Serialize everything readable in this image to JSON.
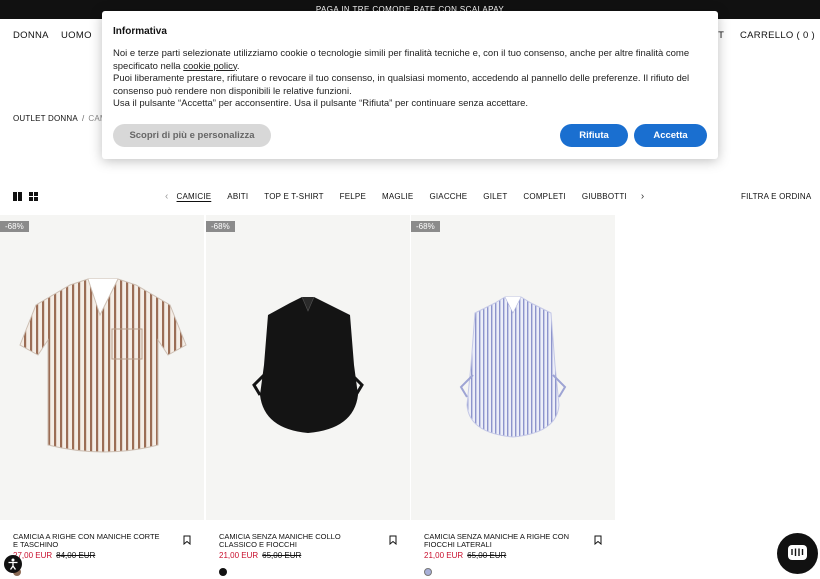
{
  "promo": {
    "text": "PAGA IN TRE COMODE RATE CON SCALAPAY"
  },
  "nav": {
    "donna": "DONNA",
    "uomo": "UOMO",
    "partial_right": "NT",
    "cart": "CARRELLO ( 0 )"
  },
  "breadcrumb": {
    "parent": "OUTLET DONNA",
    "separator": "/",
    "current": "CAM"
  },
  "categories": [
    "CAMICIE",
    "ABITI",
    "TOP E T-SHIRT",
    "FELPE",
    "MAGLIE",
    "GIACCHE",
    "GILET",
    "COMPLETI",
    "GIUBBOTTI"
  ],
  "filter_label": "FILTRA E ORDINA",
  "products": [
    {
      "badge": "-68%",
      "title": "CAMICIA A RIGHE CON MANICHE CORTE E TASCHINO",
      "price_now": "27,00 EUR",
      "price_old": "84,00 EUR",
      "swatch_color": "#8a6a55"
    },
    {
      "badge": "-68%",
      "title": "CAMICIA SENZA MANICHE COLLO CLASSICO E FIOCCHI",
      "price_now": "21,00 EUR",
      "price_old": "65,00 EUR",
      "swatch_color": "#111111"
    },
    {
      "badge": "-68%",
      "title": "CAMICIA SENZA MANICHE A RIGHE CON FIOCCHI LATERALI",
      "price_now": "21,00 EUR",
      "price_old": "65,00 EUR",
      "swatch_color": "#a8b0d8"
    }
  ],
  "cookie": {
    "title": "Informativa",
    "p1_before": "Noi e terze parti selezionate utilizziamo cookie o tecnologie simili per finalità tecniche e, con il tuo consenso, anche per altre finalità come specificato nella ",
    "p1_link": "cookie policy",
    "p1_after": ".",
    "p2": "Puoi liberamente prestare, rifiutare o revocare il tuo consenso, in qualsiasi momento, accedendo al pannello delle preferenze. Il rifiuto del consenso può rendere non disponibili le relative funzioni.",
    "p3": "Usa il pulsante “Accetta” per acconsentire. Usa il pulsante “Rifiuta” per continuare senza accettare.",
    "btn_more": "Scopri di più e personalizza",
    "btn_reject": "Rifiuta",
    "btn_accept": "Accetta"
  },
  "colors": {
    "accent": "#1a6fd0",
    "sale": "#c8102e"
  }
}
